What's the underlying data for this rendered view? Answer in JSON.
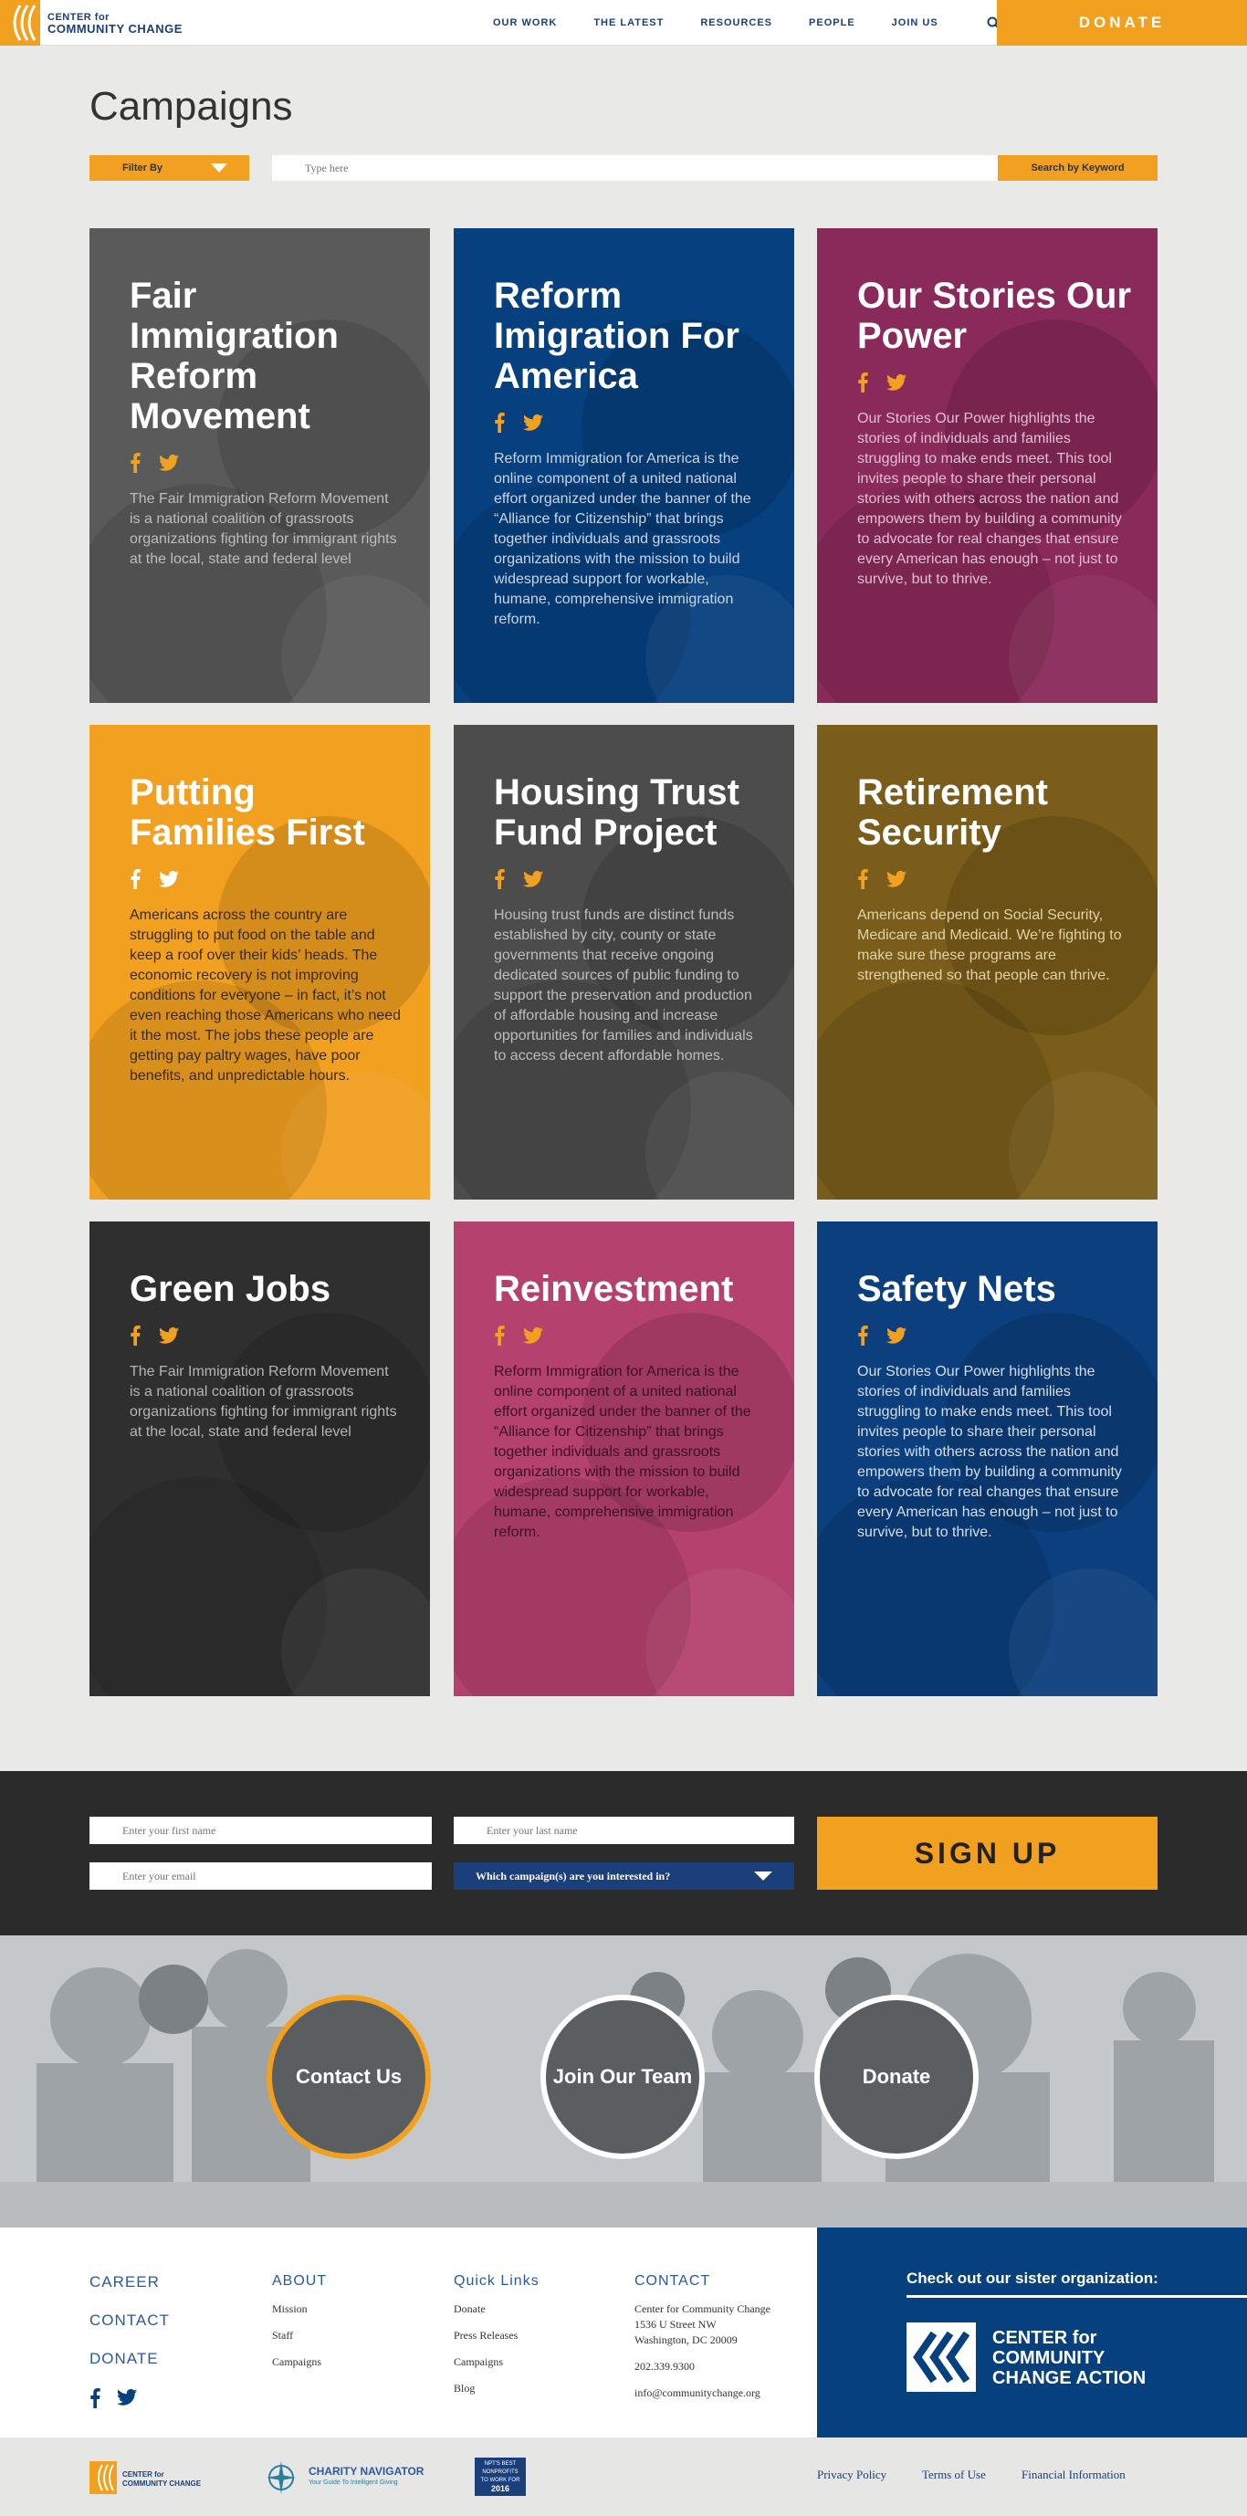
{
  "header": {
    "logo_line1": "CENTER for",
    "logo_line2": "COMMUNITY CHANGE",
    "nav": [
      "OUR WORK",
      "THE LATEST",
      "RESOURCES",
      "PEOPLE",
      "JOIN US"
    ],
    "donate": "DONATE"
  },
  "page": {
    "title": "Campaigns",
    "filter_label": "Filter By",
    "search_placeholder": "Type here",
    "search_button": "Search by Keyword"
  },
  "cards": [
    {
      "title": "Fair Immigration Reform Movement",
      "body": "The Fair Immigration Reform Movement is a national coalition of grassroots organizations fighting for immigrant rights at the local, state and federal level",
      "color": "#5a5a5a",
      "text_color": "#bdbdbd"
    },
    {
      "title": "Reform Imigration For America",
      "body": "Reform Immigration for America is the online component of a united national effort organized under the banner of the “Alliance for Citizenship” that brings together individuals and grassroots organizations with the mission to build widespread support for workable, humane, comprehensive immigration reform.",
      "color": "#06407f",
      "text_color": "#c9d4e6"
    },
    {
      "title": "Our Stories Our Power",
      "body": "Our Stories Our Power highlights the stories of individuals and families struggling to make ends meet. This tool invites people to share their personal stories with others across the nation and empowers them by building a community to advocate for real changes that ensure every American has enough – not just to survive, but to thrive.",
      "color": "#8a2a5a",
      "text_color": "#e2bfd2"
    },
    {
      "title": "Putting Families First",
      "body": "Americans across the country are struggling to put food on the table and keep a roof over their kids’ heads. The economic recovery is not improving conditions for everyone – in fact, it’s not even reaching those Americans who need it the most. The jobs these people are getting pay paltry wages, have poor benefits, and unpredictable hours.",
      "color": "#f2a01f",
      "text_color": "#3a2a10"
    },
    {
      "title": "Housing Trust Fund Project",
      "body": "Housing trust funds are distinct funds established by city, county or state governments that receive ongoing dedicated sources of public funding to support the preservation and production of affordable housing and increase opportunities for families and individuals to access decent affordable homes.",
      "color": "#4c4c4c",
      "text_color": "#bdbdbd"
    },
    {
      "title": "Retirement Security",
      "body": "Americans depend on Social Security, Medicare and Medicaid. We’re fighting to make sure these programs are strengthened so that people can thrive.",
      "color": "#7a5d1a",
      "text_color": "#e3d2a6"
    },
    {
      "title": "Green Jobs",
      "body": "The Fair Immigration Reform Movement is a national coalition of grassroots organizations fighting for immigrant rights at the local, state and federal level",
      "color": "#2f2f2f",
      "text_color": "#b5b5b5"
    },
    {
      "title": "Reinvestment",
      "body": "Reform Immigration for America is the online component of a united national effort organized under the banner of the “Alliance for Citizenship” that brings together individuals and grassroots organizations with the mission to build widespread support for workable, humane, comprehensive immigration reform.",
      "color": "#b5416f",
      "text_color": "#3d1024"
    },
    {
      "title": "Safety Nets",
      "body": "Our Stories Our Power highlights the stories of individuals and families struggling to make ends meet. This tool invites people to share their personal stories with others across the nation and empowers them by building a community to advocate for real changes that ensure every American has enough – not just to survive, but to thrive.",
      "color": "#0b3f7e",
      "text_color": "#d3deee"
    }
  ],
  "signup": {
    "first_name": "Enter your first name",
    "last_name": "Enter your last name",
    "email": "Enter your email",
    "campaign_select": "Which campaign(s) are you interested in?",
    "button": "SIGN UP"
  },
  "actions": [
    "Contact Us",
    "Join Our Team",
    "Donate"
  ],
  "footer": {
    "col1": [
      "CAREER",
      "CONTACT",
      "DONATE"
    ],
    "about_heading": "ABOUT",
    "about_links": [
      "Mission",
      "Staff",
      "Campaigns"
    ],
    "quick_heading": "Quick Links",
    "quick_links": [
      "Donate",
      "Press Releases",
      "Campaigns",
      "Blog"
    ],
    "contact_heading": "CONTACT",
    "contact_lines": [
      "Center for Community Change",
      "1536 U Street NW",
      "Washington, DC 20009",
      "202.339.9300",
      "info@communitychange.org"
    ],
    "sister_heading": "Check out our sister organization:",
    "sister_line1": "CENTER for",
    "sister_line2": "COMMUNITY",
    "sister_line3": "CHANGE ACTION",
    "bottom_links": [
      "Privacy Policy",
      "Terms of Use",
      "Financial Information"
    ],
    "badge_logo1": "CENTER for",
    "badge_logo2": "COMMUNITY CHANGE",
    "charity_nav": "CHARITY NAVIGATOR",
    "charity_nav_sub": "Your Guide To Intelligent Giving",
    "npt1": "NPT'S BEST",
    "npt2": "NONPROFITS",
    "npt3": "TO WORK FOR",
    "npt4": "2016"
  },
  "colors": {
    "orange": "#f2a01f",
    "navy": "#1a3f7a",
    "dark": "#2b2b2b"
  }
}
